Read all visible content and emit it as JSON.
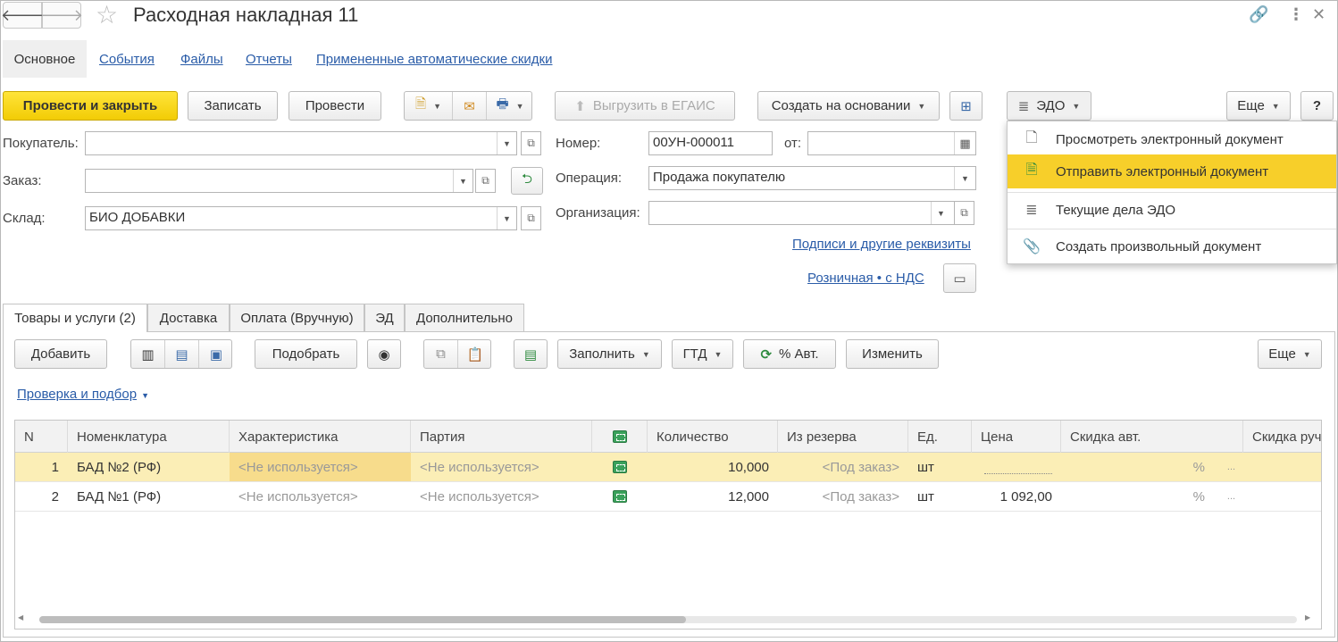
{
  "window": {
    "title": "Расходная накладная 11"
  },
  "page_tabs": {
    "active": "Основное",
    "links": [
      "События",
      "Файлы",
      "Отчеты",
      "Примененные автоматические скидки"
    ]
  },
  "toolbar": {
    "post_close": "Провести и закрыть",
    "save": "Записать",
    "post": "Провести",
    "egais": "Выгрузить в ЕГАИС",
    "create_based": "Создать на основании",
    "edo": "ЭДО",
    "more": "Еще",
    "help": "?"
  },
  "form": {
    "buyer_label": "Покупатель:",
    "buyer_value": "",
    "order_label": "Заказ:",
    "order_value": "",
    "warehouse_label": "Склад:",
    "warehouse_value": "БИО ДОБАВКИ",
    "number_label": "Номер:",
    "number_value": "00УН-000011",
    "date_label": "от:",
    "date_value": "",
    "operation_label": "Операция:",
    "operation_value": "Продажа покупателю",
    "org_label": "Организация:",
    "org_value": "",
    "signatures_link": "Подписи и другие реквизиты",
    "price_link": "Розничная • с НДС"
  },
  "edo_menu": {
    "items": [
      {
        "label": "Просмотреть электронный документ",
        "icon": "document-icon",
        "active": false
      },
      {
        "label": "Отправить электронный документ",
        "icon": "send-document-icon",
        "active": true
      },
      {
        "label": "Текущие дела ЭДО",
        "icon": "edo-tasks-icon",
        "active": false
      },
      {
        "label": "Создать произвольный документ",
        "icon": "paperclip-icon",
        "active": false
      }
    ]
  },
  "inner_tabs": [
    "Товары и услуги (2)",
    "Доставка",
    "Оплата (Вручную)",
    "ЭД",
    "Дополнительно"
  ],
  "table_toolbar": {
    "add": "Добавить",
    "pick": "Подобрать",
    "fill": "Заполнить",
    "gtd": "ГТД",
    "auto_pct": "% Авт.",
    "change": "Изменить",
    "more": "Еще",
    "check_link": "Проверка и подбор"
  },
  "table": {
    "columns": [
      "N",
      "Номенклатура",
      "Характеристика",
      "Партия",
      "",
      "Количество",
      "Из резерва",
      "Ед.",
      "Цена",
      "Скидка авт.",
      "Скидка руч"
    ],
    "rows": [
      {
        "n": "1",
        "item": "БАД №2 (РФ)",
        "char": "<Не используется>",
        "batch": "<Не используется>",
        "qty": "10,000",
        "reserve": "<Под заказ>",
        "unit": "шт",
        "price": "",
        "disc_pct": "%",
        "dots": "...",
        "selected": true
      },
      {
        "n": "2",
        "item": "БАД №1 (РФ)",
        "char": "<Не используется>",
        "batch": "<Не используется>",
        "qty": "12,000",
        "reserve": "<Под заказ>",
        "unit": "шт",
        "price": "1 092,00",
        "disc_pct": "%",
        "dots": "...",
        "selected": false
      }
    ]
  },
  "colors": {
    "accent_yellow": "#f7cf2a",
    "link_blue": "#2a5ca8",
    "selected_row": "#fbeeb6"
  }
}
